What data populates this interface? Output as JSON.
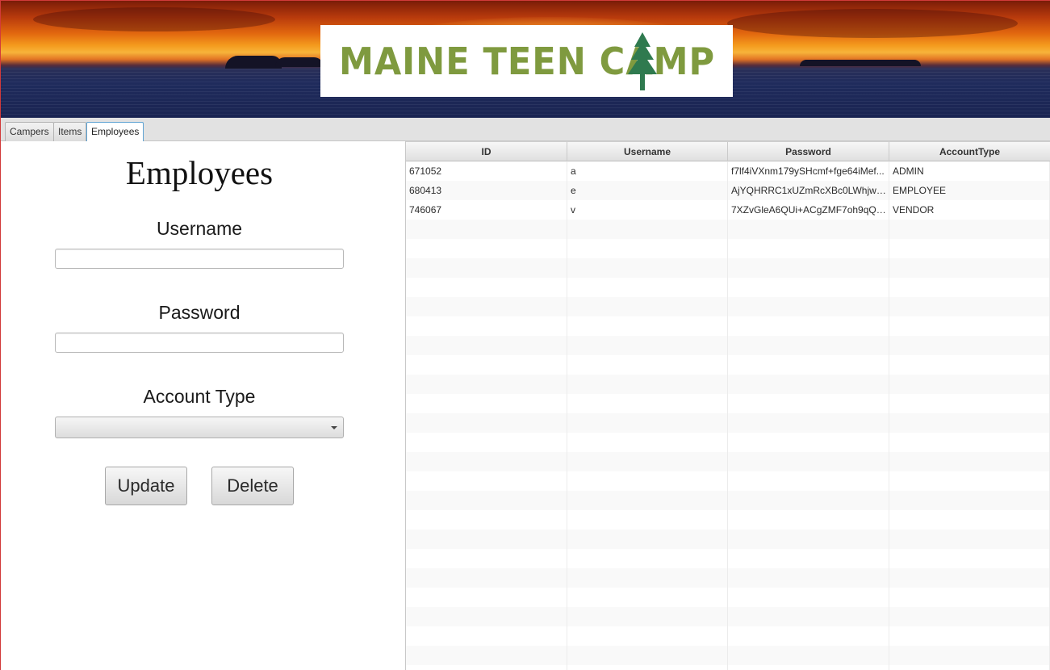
{
  "banner": {
    "logo_text": "MAINE TEEN CAMP",
    "logo_color": "#7f9a3f",
    "tree_color": "#2f7a4f"
  },
  "tabs": [
    {
      "label": "Campers",
      "active": false
    },
    {
      "label": "Items",
      "active": false
    },
    {
      "label": "Employees",
      "active": true
    }
  ],
  "form": {
    "title": "Employees",
    "username_label": "Username",
    "username_value": "",
    "password_label": "Password",
    "password_value": "",
    "account_type_label": "Account Type",
    "account_type_value": "",
    "update_label": "Update",
    "delete_label": "Delete"
  },
  "table": {
    "columns": [
      "ID",
      "Username",
      "Password",
      "AccountType"
    ],
    "rows": [
      [
        "671052",
        "a",
        "f7lf4iVXnm179ySHcmf+fge64iMef...",
        "ADMIN"
      ],
      [
        "680413",
        "e",
        "AjYQHRRC1xUZmRcXBc0LWhjwo...",
        "EMPLOYEE"
      ],
      [
        "746067",
        "v",
        "7XZvGleA6QUi+ACgZMF7oh9qQL...",
        "VENDOR"
      ]
    ]
  }
}
